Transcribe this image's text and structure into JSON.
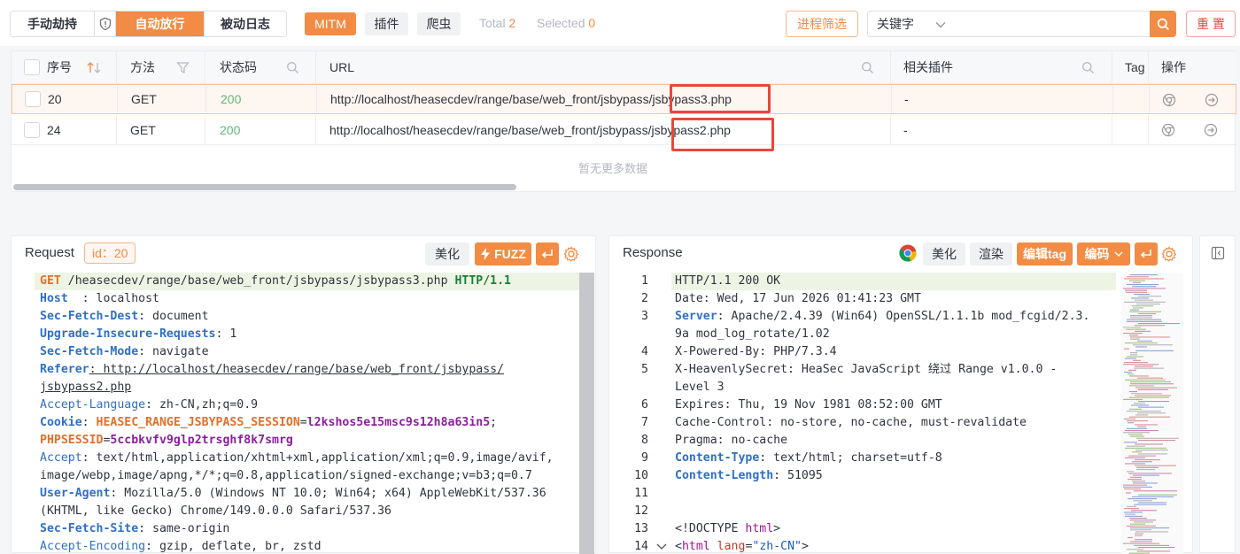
{
  "toolbar": {
    "mode_manual": "手动劫持",
    "mode_auto": "自动放行",
    "mode_passive": "被动日志",
    "tag_mitm": "MITM",
    "tag_plugin": "插件",
    "tag_crawler": "爬虫",
    "total_label": "Total",
    "total_count": "2",
    "selected_label": "Selected",
    "selected_count": "0",
    "process_filter": "进程筛选",
    "search_type": "关键字",
    "search_placeholder": "",
    "reset": "重 置"
  },
  "table": {
    "headers": {
      "seq": "序号",
      "method": "方法",
      "status": "状态码",
      "url": "URL",
      "plugins": "相关插件",
      "tag": "Tag",
      "ops": "操作"
    },
    "rows": [
      {
        "seq": "20",
        "method": "GET",
        "status": "200",
        "url_prefix": "http://localhost/heasecdev/range/base/web_front/jsbypas",
        "url_boxed": "s/jsbypass3.php",
        "plugins": "-"
      },
      {
        "seq": "24",
        "method": "GET",
        "status": "200",
        "url_prefix": "http://localhost/heasecdev/range/base/web_front/jsbypas",
        "url_boxed": "s/jsbypass2.php",
        "plugins": "-"
      }
    ],
    "empty_text": "暂无更多数据"
  },
  "request": {
    "title": "Request",
    "id_label": "id：20",
    "beautify": "美化",
    "fuzz": "FUZZ",
    "lines": [
      [
        {
          "t": "GET",
          "c": "red"
        },
        {
          "t": " /heasecdev/range/base/web_front/jsbypass/jsbypass3.php ",
          "c": ""
        },
        {
          "t": "HTTP/1.1",
          "c": "grn"
        }
      ],
      [
        {
          "t": "Host",
          "c": "k"
        },
        {
          "t": "  : localhost",
          "c": ""
        }
      ],
      [
        {
          "t": "Sec-Fetch-Dest",
          "c": "k"
        },
        {
          "t": ": document",
          "c": ""
        }
      ],
      [
        {
          "t": "Upgrade-Insecure-Requests",
          "c": "k"
        },
        {
          "t": ": 1",
          "c": ""
        }
      ],
      [
        {
          "t": "Sec-Fetch-Mode",
          "c": "k"
        },
        {
          "t": ": navigate",
          "c": ""
        }
      ],
      [
        {
          "t": "Referer",
          "c": "k"
        },
        {
          "t": ": http://localhost/heasecdev/range/base/web_front/jsbypass/",
          "c": "u"
        }
      ],
      [
        {
          "t": "jsbypass2.php",
          "c": "u"
        }
      ],
      [
        {
          "t": "Accept-Language",
          "c": "kn"
        },
        {
          "t": ": zh-CN,zh;q=0.9",
          "c": ""
        }
      ],
      [
        {
          "t": "Cookie",
          "c": "k"
        },
        {
          "t": ": ",
          "c": ""
        },
        {
          "t": "HEASEC_RANGE_JSBYPASS_SESSION",
          "c": "red"
        },
        {
          "t": "=",
          "c": ""
        },
        {
          "t": "l2kshos5e15msc9s12h8a63in5",
          "c": "pur"
        },
        {
          "t": ";",
          "c": ""
        }
      ],
      [
        {
          "t": "PHPSESSID",
          "c": "red"
        },
        {
          "t": "=",
          "c": ""
        },
        {
          "t": "5ccbkvfv9glp2trsghf8k7smrg",
          "c": "pur"
        }
      ],
      [
        {
          "t": "Accept",
          "c": "kn"
        },
        {
          "t": ": text/html,application/xhtml+xml,application/xml;q=0.9,image/avif,",
          "c": ""
        }
      ],
      [
        {
          "t": "image/webp,image/apng,*/*;q=0.8,application/signed-exchange;v=b3;q=0.7",
          "c": ""
        }
      ],
      [
        {
          "t": "User-Agent",
          "c": "k"
        },
        {
          "t": ": Mozilla/5.0 (Windows NT 10.0; Win64; x64) AppleWebKit/537.36",
          "c": ""
        }
      ],
      [
        {
          "t": "(KHTML, like Gecko) Chrome/149.0.0.0 Safari/537.36",
          "c": ""
        }
      ],
      [
        {
          "t": "Sec-Fetch-Site",
          "c": "k"
        },
        {
          "t": ": same-origin",
          "c": ""
        }
      ],
      [
        {
          "t": "Accept-Encoding",
          "c": "kn"
        },
        {
          "t": ": gzip, deflate, br, zstd",
          "c": ""
        }
      ]
    ]
  },
  "response": {
    "title": "Response",
    "beautify": "美化",
    "render": "渲染",
    "edit_tag": "编辑tag",
    "encode": "编码",
    "lines": [
      {
        "n": "1",
        "s": [
          {
            "t": "HTTP/1.1 200 OK",
            "c": ""
          }
        ]
      },
      {
        "n": "2",
        "s": [
          {
            "t": "Date: Wed, 17 Jun 2026 01:41:23 GMT",
            "c": ""
          }
        ]
      },
      {
        "n": "3",
        "s": [
          {
            "t": "Server",
            "c": "k"
          },
          {
            "t": ": Apache/2.4.39 (Win64) OpenSSL/1.1.1b mod_fcgid/2.3.",
            "c": ""
          }
        ]
      },
      {
        "n": "",
        "s": [
          {
            "t": "9a mod_log_rotate/1.02",
            "c": ""
          }
        ]
      },
      {
        "n": "4",
        "s": [
          {
            "t": "X-Powered-By: PHP/7.3.4",
            "c": ""
          }
        ]
      },
      {
        "n": "5",
        "s": [
          {
            "t": "X-HeavenlySecret: HeaSec JavaScript 绕过 Range v1.0.0 -",
            "c": ""
          }
        ]
      },
      {
        "n": "",
        "s": [
          {
            "t": "Level 3",
            "c": ""
          }
        ]
      },
      {
        "n": "6",
        "s": [
          {
            "t": "Expires: Thu, 19 Nov 1981 08:52:00 GMT",
            "c": ""
          }
        ]
      },
      {
        "n": "7",
        "s": [
          {
            "t": "Cache-Control: no-store, no-cache, must-revalidate",
            "c": ""
          }
        ]
      },
      {
        "n": "8",
        "s": [
          {
            "t": "Pragma: no-cache",
            "c": ""
          }
        ]
      },
      {
        "n": "9",
        "s": [
          {
            "t": "Content-Type",
            "c": "k"
          },
          {
            "t": ": text/html; charset=utf-8",
            "c": ""
          }
        ]
      },
      {
        "n": "10",
        "s": [
          {
            "t": "Content-Length",
            "c": "k"
          },
          {
            "t": ": 51095",
            "c": ""
          }
        ]
      },
      {
        "n": "11",
        "s": []
      },
      {
        "n": "12",
        "s": []
      },
      {
        "n": "13",
        "s": [
          {
            "t": "<!DOCTYPE ",
            "c": ""
          },
          {
            "t": "html",
            "c": "pur2"
          },
          {
            "t": ">",
            "c": ""
          }
        ]
      },
      {
        "n": "14",
        "s": [
          {
            "t": "<",
            "c": ""
          },
          {
            "t": "html",
            "c": "pur2"
          },
          {
            "t": " ",
            "c": ""
          },
          {
            "t": "lang",
            "c": "red2"
          },
          {
            "t": "=",
            "c": ""
          },
          {
            "t": "\"zh-CN\"",
            "c": "str"
          },
          {
            "t": ">",
            "c": ""
          }
        ]
      }
    ]
  }
}
